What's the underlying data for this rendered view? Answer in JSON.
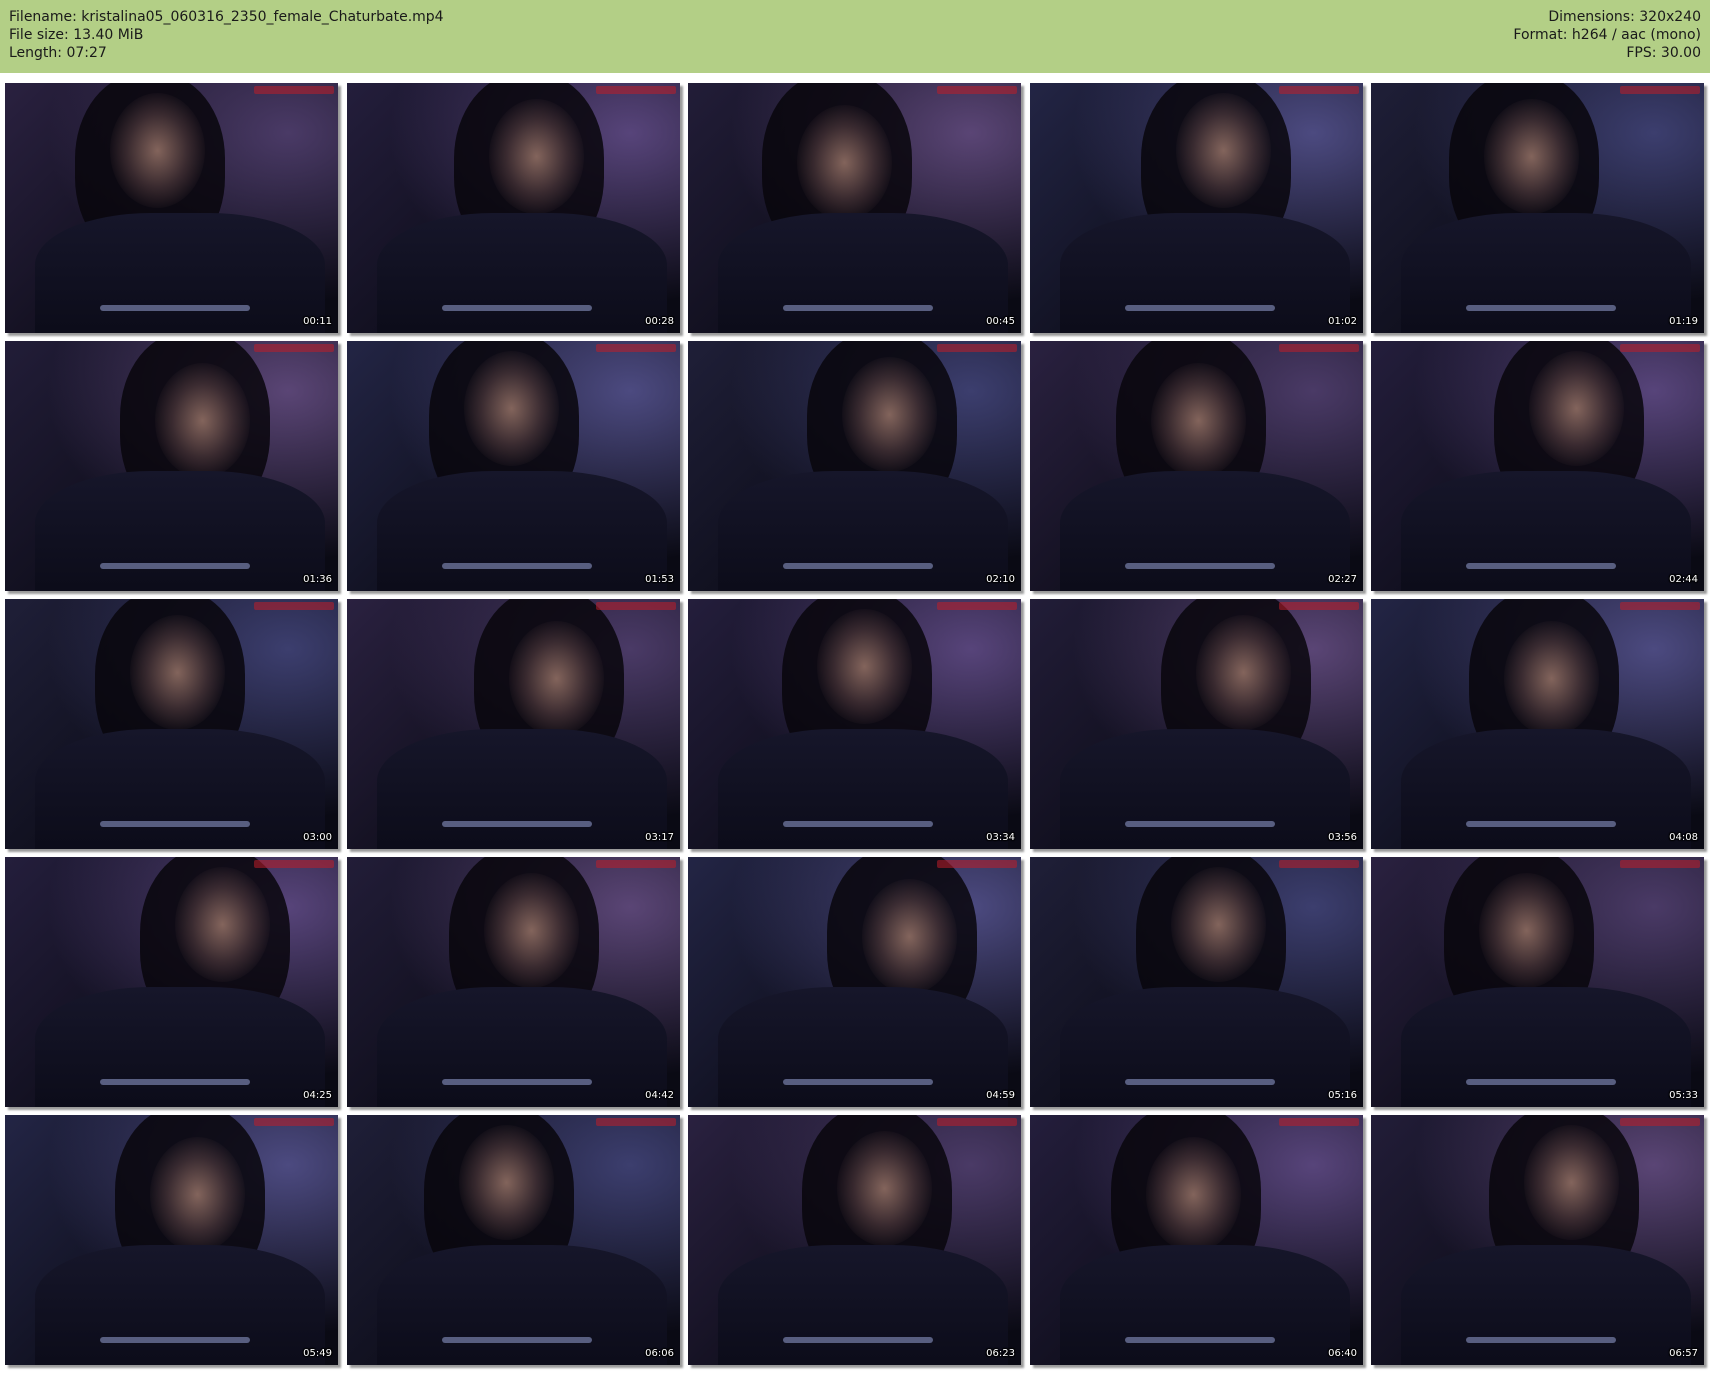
{
  "header": {
    "filename": "Filename: kristalina05_060316_2350_female_Chaturbate.mp4",
    "filesize": "File size: 13.40 MiB",
    "length": "Length: 07:27",
    "dimensions": "Dimensions: 320x240",
    "format": "Format: h264 / aac (mono)",
    "fps": "FPS: 30.00"
  },
  "colors": {
    "header_background": "#b3cf86",
    "page_background": "#ffffff"
  },
  "thumbnails": [
    {
      "timestamp": "00:11"
    },
    {
      "timestamp": "00:28"
    },
    {
      "timestamp": "00:45"
    },
    {
      "timestamp": "01:02"
    },
    {
      "timestamp": "01:19"
    },
    {
      "timestamp": "01:36"
    },
    {
      "timestamp": "01:53"
    },
    {
      "timestamp": "02:10"
    },
    {
      "timestamp": "02:27"
    },
    {
      "timestamp": "02:44"
    },
    {
      "timestamp": "03:00"
    },
    {
      "timestamp": "03:17"
    },
    {
      "timestamp": "03:34"
    },
    {
      "timestamp": "03:56"
    },
    {
      "timestamp": "04:08"
    },
    {
      "timestamp": "04:25"
    },
    {
      "timestamp": "04:42"
    },
    {
      "timestamp": "04:59"
    },
    {
      "timestamp": "05:16"
    },
    {
      "timestamp": "05:33"
    },
    {
      "timestamp": "05:49"
    },
    {
      "timestamp": "06:06"
    },
    {
      "timestamp": "06:23"
    },
    {
      "timestamp": "06:40"
    },
    {
      "timestamp": "06:57"
    }
  ]
}
